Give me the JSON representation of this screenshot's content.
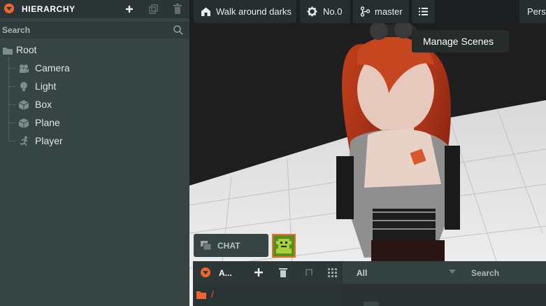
{
  "hierarchy": {
    "title": "HIERARCHY",
    "search_placeholder": "Search",
    "icons": {
      "add": "plus-icon",
      "duplicate": "duplicate-icon",
      "delete": "trash-icon",
      "menu": "orange-chevron-icon"
    },
    "items": [
      {
        "label": "Root",
        "icon": "folder-icon"
      },
      {
        "label": "Camera",
        "icon": "camera-icon"
      },
      {
        "label": "Light",
        "icon": "lightbulb-icon"
      },
      {
        "label": "Box",
        "icon": "cube-icon"
      },
      {
        "label": "Plane",
        "icon": "cube-icon"
      },
      {
        "label": "Player",
        "icon": "running-person-icon"
      }
    ]
  },
  "toolbar": {
    "project": "Walk around darks",
    "scene": "No.0",
    "branch": "master",
    "users_partial": "Pers",
    "tooltip": "Manage Scenes"
  },
  "chat": {
    "label": "CHAT"
  },
  "assets": {
    "title": "A...",
    "filter": "All",
    "search_placeholder": "Search",
    "path": "/"
  },
  "colors": {
    "accent": "#f0652b",
    "panel": "#364444",
    "panel_dark": "#2b3535",
    "text": "#dfe6e5"
  }
}
